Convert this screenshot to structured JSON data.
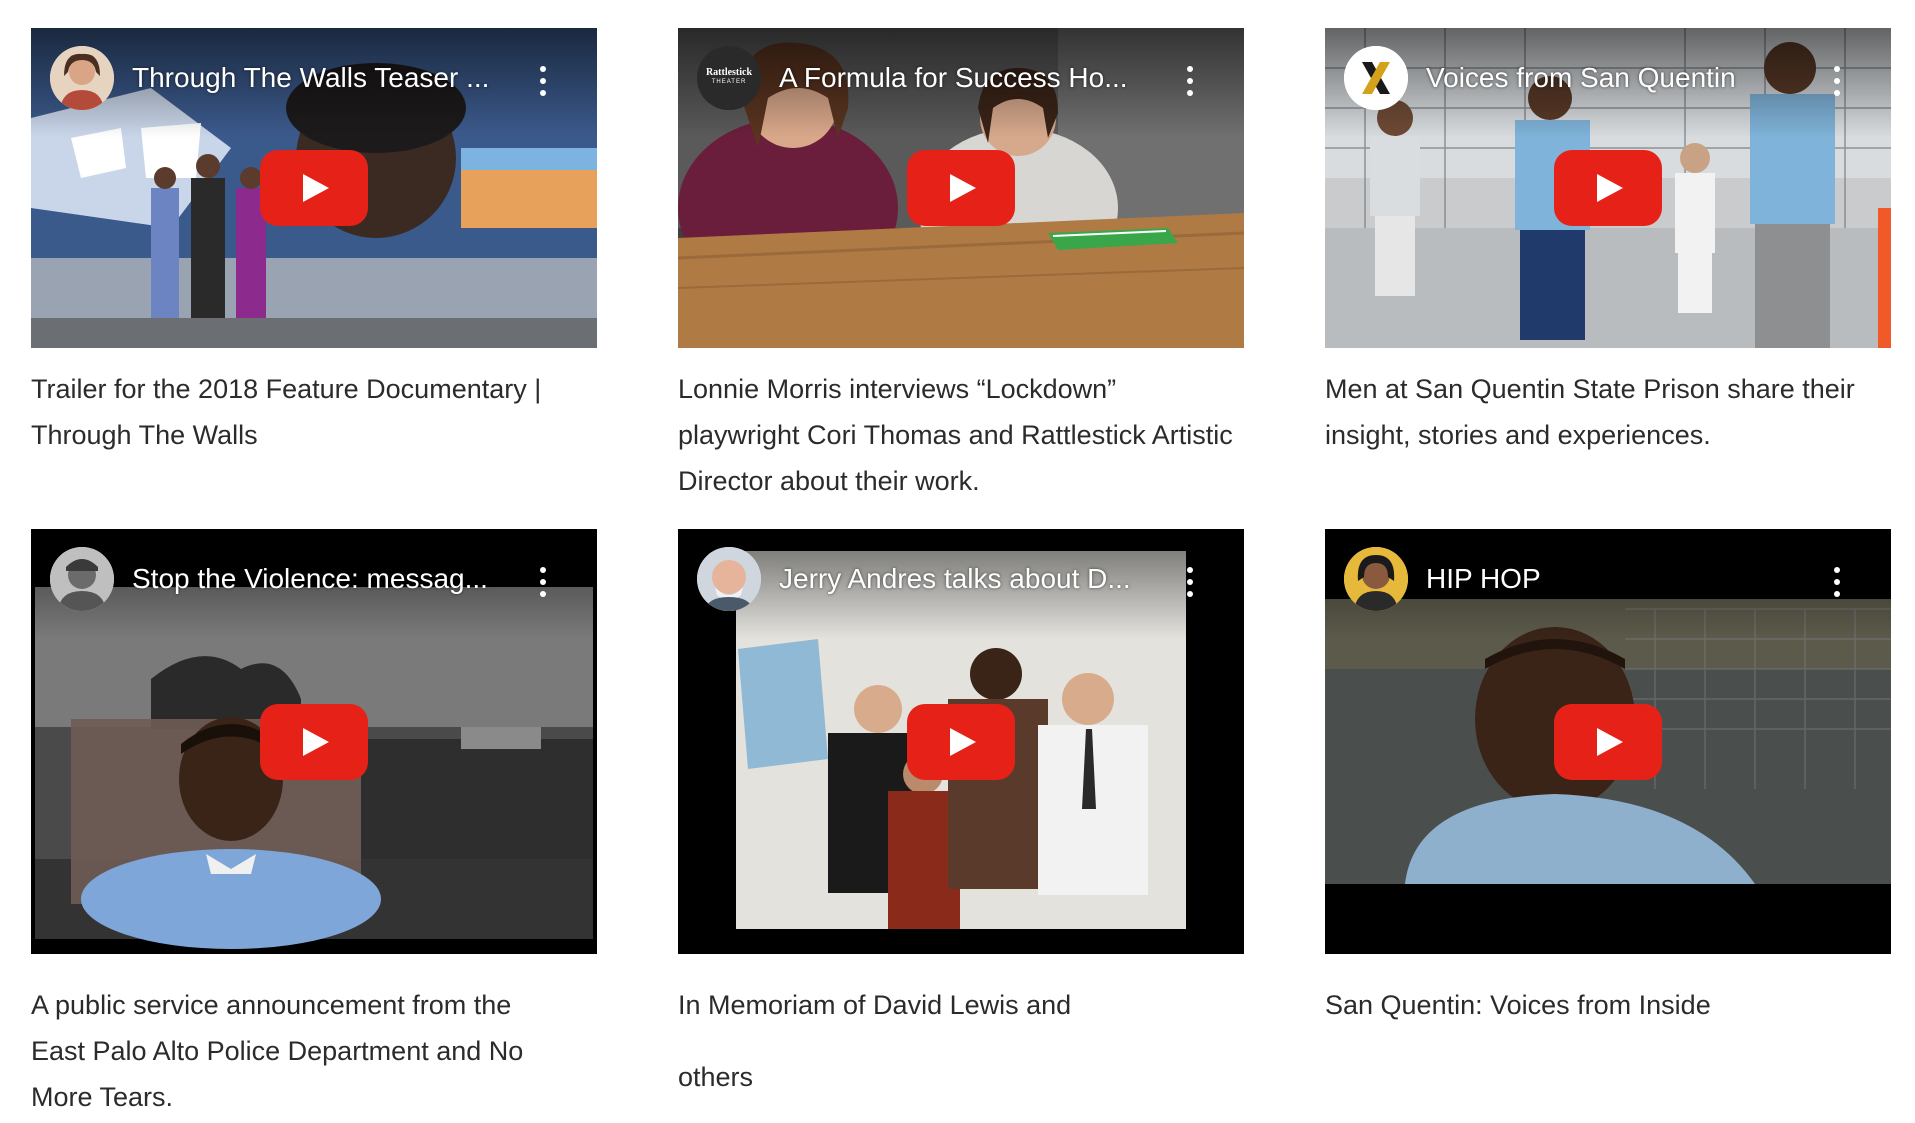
{
  "videos": [
    {
      "title": "Through The Walls Teaser ...",
      "caption": "Trailer for the 2018 Feature Documentary | Through The Walls",
      "avatar_icon": "woman-portrait-avatar"
    },
    {
      "title": "A Formula for Success Ho...",
      "caption": "Lonnie Morris interviews “Lockdown” playwright Cori Thomas and Rattlestick Artistic Director about their work.",
      "avatar_icon": "rattlestick-logo-avatar",
      "avatar_text": "Rattlestick",
      "avatar_subtext": "THEATER"
    },
    {
      "title": "Voices from San Quentin",
      "caption": "Men at San Quentin State Prison share their insight, stories and experiences.",
      "avatar_icon": "x-logo-avatar"
    },
    {
      "title": "Stop the Violence: messag...",
      "caption": "A public service announcement from the East Palo Alto Police Department and No More Tears.",
      "avatar_icon": "man-portrait-avatar"
    },
    {
      "title": "Jerry Andres talks about D...",
      "caption_line1": "In Memoriam of David Lewis and",
      "caption_line2": "others",
      "avatar_icon": "older-man-portrait-avatar"
    },
    {
      "title": "HIP HOP",
      "caption": "San Quentin: Voices from Inside",
      "avatar_icon": "woman-portrait-avatar"
    }
  ],
  "colors": {
    "play_red": "#e62117",
    "caption_text": "#2b2b2b"
  }
}
